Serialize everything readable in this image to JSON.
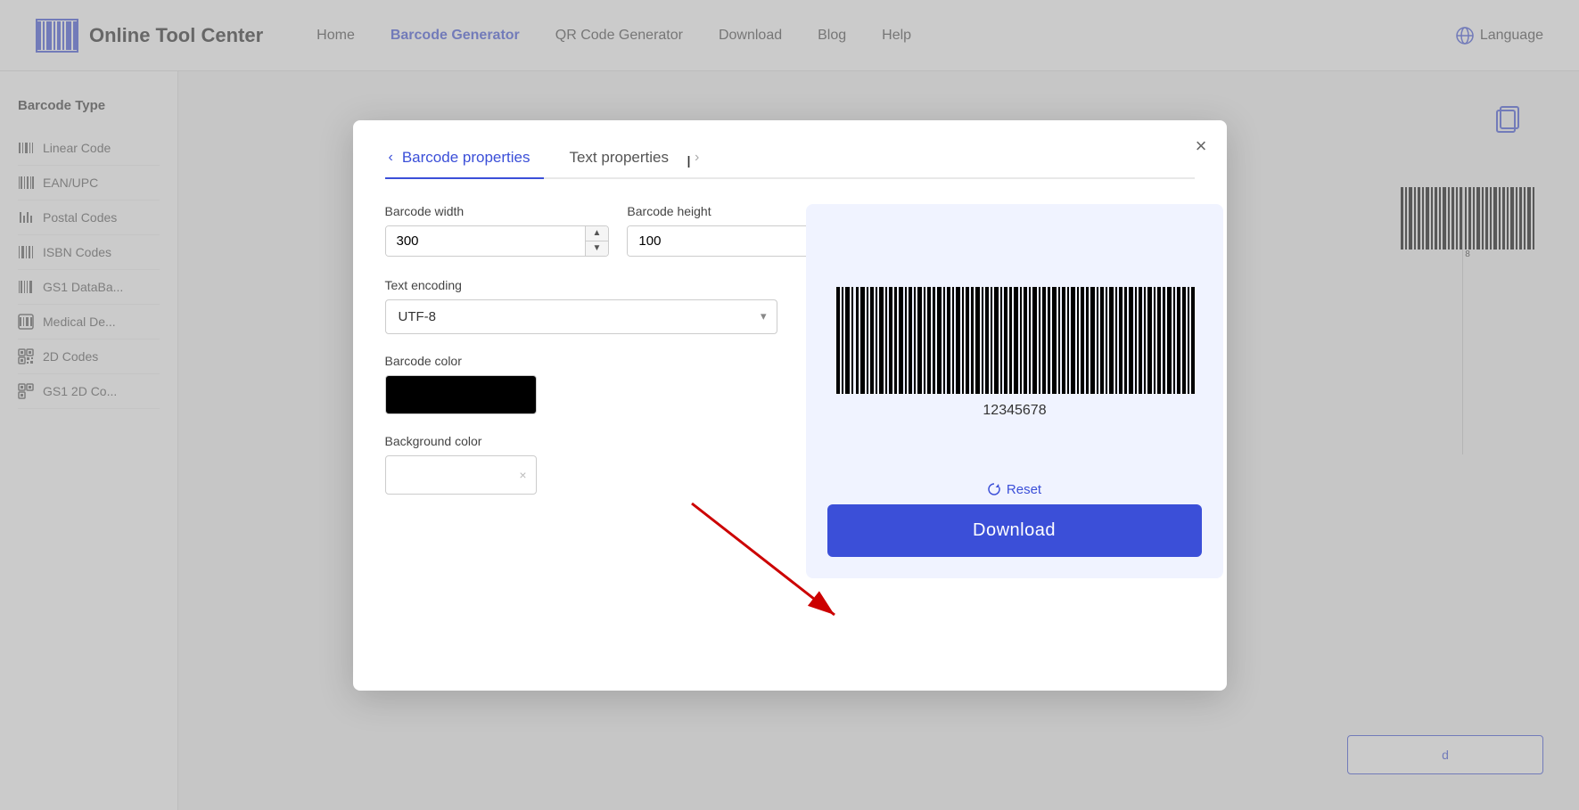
{
  "header": {
    "logo_text": "Online Tool Center",
    "nav_items": [
      {
        "label": "Home",
        "active": false
      },
      {
        "label": "Barcode Generator",
        "active": true
      },
      {
        "label": "QR Code Generator",
        "active": false
      },
      {
        "label": "Download",
        "active": false
      },
      {
        "label": "Blog",
        "active": false
      },
      {
        "label": "Help",
        "active": false
      },
      {
        "label": "Language",
        "active": false
      }
    ]
  },
  "sidebar": {
    "title": "Barcode Type",
    "items": [
      {
        "label": "Linear Code"
      },
      {
        "label": "EAN/UPC"
      },
      {
        "label": "Postal Codes"
      },
      {
        "label": "ISBN Codes"
      },
      {
        "label": "GS1 DataBa..."
      },
      {
        "label": "Medical De..."
      },
      {
        "label": "2D Codes"
      },
      {
        "label": "GS1 2D Co..."
      }
    ]
  },
  "modal": {
    "tab_barcode_props": "Barcode properties",
    "tab_text_props": "Text properties",
    "close_label": "×",
    "fields": {
      "barcode_width_label": "Barcode width",
      "barcode_width_value": "300",
      "barcode_height_label": "Barcode height",
      "barcode_height_value": "100",
      "text_encoding_label": "Text encoding",
      "text_encoding_value": "UTF-8",
      "barcode_color_label": "Barcode color",
      "background_color_label": "Background color"
    },
    "barcode_number": "12345678",
    "reset_label": "Reset",
    "download_label": "Download"
  }
}
